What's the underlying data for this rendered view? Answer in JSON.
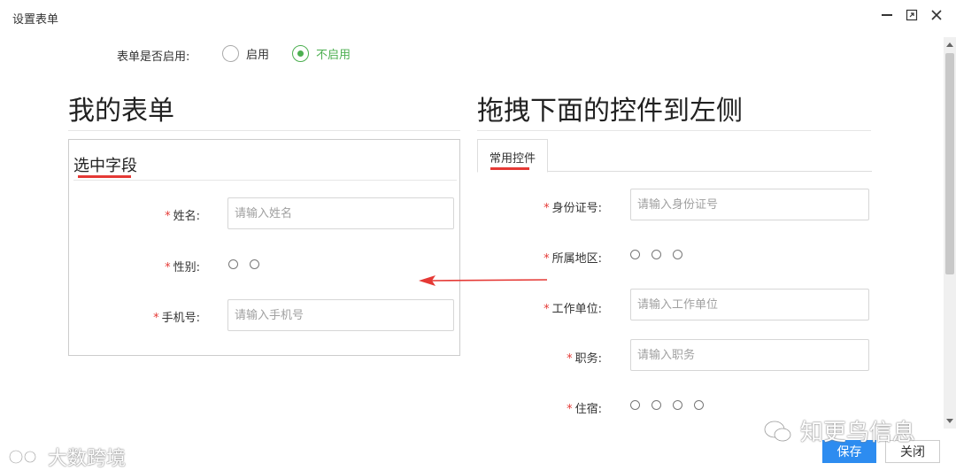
{
  "window": {
    "title": "设置表单",
    "minimize_icon": "minimize-icon",
    "maximize_icon": "maximize-icon",
    "close_icon": "close-icon"
  },
  "enable": {
    "label": "表单是否启用:",
    "options": [
      {
        "label": "启用",
        "checked": false
      },
      {
        "label": "不启用",
        "checked": true
      }
    ]
  },
  "left": {
    "heading": "我的表单",
    "section_title": "选中字段",
    "fields": [
      {
        "label": "姓名:",
        "required": "*",
        "type": "text",
        "placeholder": "请输入姓名"
      },
      {
        "label": "性别:",
        "required": "*",
        "type": "radio",
        "radio_count": 2
      },
      {
        "label": "手机号:",
        "required": "*",
        "type": "text",
        "placeholder": "请输入手机号"
      }
    ]
  },
  "right": {
    "heading": "拖拽下面的控件到左侧",
    "tab": "常用控件",
    "fields": [
      {
        "label": "身份证号:",
        "required": "*",
        "type": "text",
        "placeholder": "请输入身份证号"
      },
      {
        "label": "所属地区:",
        "required": "*",
        "type": "radio",
        "radio_count": 3
      },
      {
        "label": "工作单位:",
        "required": "*",
        "type": "text",
        "placeholder": "请输入工作单位"
      },
      {
        "label": "职务:",
        "required": "*",
        "type": "text",
        "placeholder": "请输入职务"
      },
      {
        "label": "住宿:",
        "required": "*",
        "type": "radio",
        "radio_count": 4
      }
    ]
  },
  "footer": {
    "save": "保存",
    "close": "关闭"
  },
  "watermarks": {
    "left": "大数跨境",
    "right": "知更鸟信息"
  },
  "colors": {
    "accent_green": "#4caf50",
    "annotation_red": "#e53935",
    "primary_blue": "#2d8cf0"
  }
}
